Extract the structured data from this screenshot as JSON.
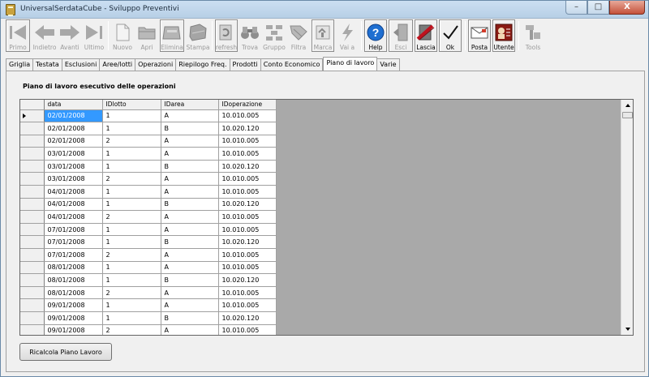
{
  "window": {
    "title": "UniversalSerdataCube - Sviluppo Preventivi",
    "minimize": "–",
    "maximize": "□",
    "close": "X"
  },
  "toolbar": {
    "primo": "Primo",
    "indietro": "Indietro",
    "avanti": "Avanti",
    "ultimo": "Ultimo",
    "nuovo": "Nuovo",
    "apri": "Apri",
    "elimina": "Elimina",
    "stampa": "Stampa",
    "refresh": "refresh",
    "trova": "Trova",
    "gruppo": "Gruppo",
    "filtra": "Filtra",
    "marca": "Marca",
    "vai_a": "Vai a",
    "help": "Help",
    "esci": "Esci",
    "lascia": "Lascia",
    "ok": "Ok",
    "posta": "Posta",
    "utente": "Utente",
    "tools": "Tools"
  },
  "tabs": [
    "Griglia",
    "Testata",
    "Esclusioni",
    "Aree/lotti",
    "Operazioni",
    "Riepilogo Freq.",
    "Prodotti",
    "Conto Economico",
    "Piano di lavoro",
    "Varie"
  ],
  "active_tab": "Piano di lavoro",
  "section_title": "Piano di lavoro esecutivo delle operazioni",
  "grid": {
    "columns": [
      "data",
      "IDlotto",
      "IDarea",
      "IDoperazione"
    ],
    "rows": [
      [
        "02/01/2008",
        "1",
        "A",
        "10.010.005"
      ],
      [
        "02/01/2008",
        "1",
        "B",
        "10.020.120"
      ],
      [
        "02/01/2008",
        "2",
        "A",
        "10.010.005"
      ],
      [
        "03/01/2008",
        "1",
        "A",
        "10.010.005"
      ],
      [
        "03/01/2008",
        "1",
        "B",
        "10.020.120"
      ],
      [
        "03/01/2008",
        "2",
        "A",
        "10.010.005"
      ],
      [
        "04/01/2008",
        "1",
        "A",
        "10.010.005"
      ],
      [
        "04/01/2008",
        "1",
        "B",
        "10.020.120"
      ],
      [
        "04/01/2008",
        "2",
        "A",
        "10.010.005"
      ],
      [
        "07/01/2008",
        "1",
        "A",
        "10.010.005"
      ],
      [
        "07/01/2008",
        "1",
        "B",
        "10.020.120"
      ],
      [
        "07/01/2008",
        "2",
        "A",
        "10.010.005"
      ],
      [
        "08/01/2008",
        "1",
        "A",
        "10.010.005"
      ],
      [
        "08/01/2008",
        "1",
        "B",
        "10.020.120"
      ],
      [
        "08/01/2008",
        "2",
        "A",
        "10.010.005"
      ],
      [
        "09/01/2008",
        "1",
        "A",
        "10.010.005"
      ],
      [
        "09/01/2008",
        "1",
        "B",
        "10.020.120"
      ],
      [
        "09/01/2008",
        "2",
        "A",
        "10.010.005"
      ]
    ]
  },
  "action_button": "Ricalcola Piano Lavoro",
  "colors": {
    "selection": "#3399ff",
    "grid_background": "#a9a9a9",
    "help_icon": "#1f6fd1",
    "lascia_icon": "#c0121e"
  }
}
